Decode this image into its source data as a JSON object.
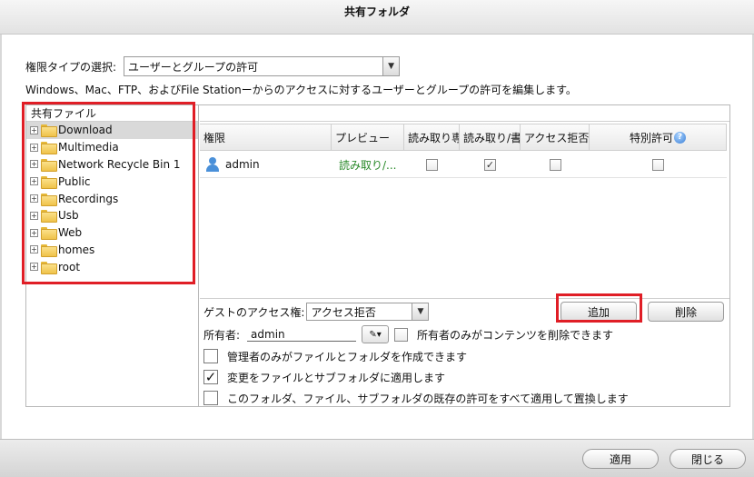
{
  "window": {
    "title": "共有フォルダ"
  },
  "permission_type": {
    "label": "権限タイプの選択:",
    "selected": "ユーザーとグループの許可"
  },
  "description": "Windows、Mac、FTP、およびFile Stationーからのアクセスに対するユーザーとグループの許可を編集します。",
  "tree": {
    "header": "共有ファイル",
    "items": [
      "Download",
      "Multimedia",
      "Network Recycle Bin 1",
      "Public",
      "Recordings",
      "Usb",
      "Web",
      "homes",
      "root"
    ]
  },
  "grid": {
    "columns": [
      "権限",
      "プレビュー",
      "読み取り専用",
      "読み取り/書き込み",
      "アクセス拒否",
      "特別許可"
    ],
    "rows": [
      {
        "name": "admin",
        "preview": "読み取り/...",
        "read_only": false,
        "read_write": true,
        "deny": false,
        "special": false
      }
    ]
  },
  "guest": {
    "label": "ゲストのアクセス権:",
    "selected": "アクセス拒否"
  },
  "buttons": {
    "add": "追加",
    "delete": "削除",
    "apply": "適用",
    "close": "閉じる"
  },
  "owner": {
    "label": "所有者:",
    "value": "admin",
    "only_owner_delete": "所有者のみがコンテンツを削除できます"
  },
  "options": [
    {
      "label": "管理者のみがファイルとフォルダを作成できます",
      "checked": false
    },
    {
      "label": "変更をファイルとサブフォルダに適用します",
      "checked": true
    },
    {
      "label": "このフォルダ、ファイル、サブフォルダの既存の許可をすべて適用して置換します",
      "checked": false
    }
  ],
  "colors": {
    "highlight": "#e01e26",
    "preview_text": "#2a8a2a",
    "user_icon": "#4a90d9"
  }
}
